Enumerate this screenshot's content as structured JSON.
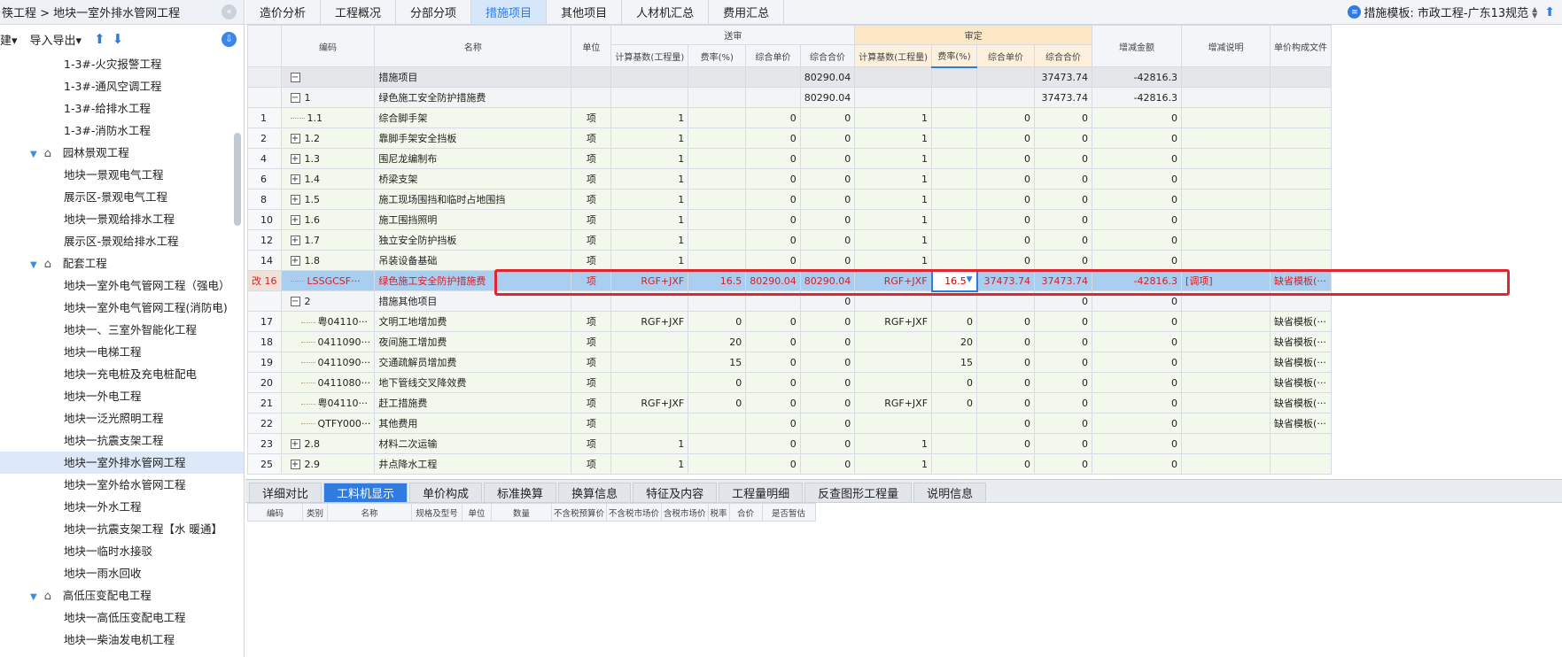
{
  "sidebar": {
    "breadcrumb": "筷工程 > 地块一室外排水管网工程",
    "tools": {
      "new_label": "建▾",
      "import_export_label": "导入导出▾"
    },
    "tree": [
      {
        "label": "1-3#-火灾报警工程",
        "type": "leaf"
      },
      {
        "label": "1-3#-通风空调工程",
        "type": "leaf"
      },
      {
        "label": "1-3#-给排水工程",
        "type": "leaf"
      },
      {
        "label": "1-3#-消防水工程",
        "type": "leaf"
      },
      {
        "label": "园林景观工程",
        "type": "group"
      },
      {
        "label": "地块一景观电气工程",
        "type": "leaf"
      },
      {
        "label": "展示区-景观电气工程",
        "type": "leaf"
      },
      {
        "label": "地块一景观给排水工程",
        "type": "leaf"
      },
      {
        "label": "展示区-景观给排水工程",
        "type": "leaf"
      },
      {
        "label": "配套工程",
        "type": "group"
      },
      {
        "label": "地块一室外电气管网工程（强电）",
        "type": "leaf"
      },
      {
        "label": "地块一室外电气管网工程(消防电)",
        "type": "leaf"
      },
      {
        "label": "地块一、三室外智能化工程",
        "type": "leaf"
      },
      {
        "label": "地块一电梯工程",
        "type": "leaf"
      },
      {
        "label": "地块一充电桩及充电桩配电",
        "type": "leaf"
      },
      {
        "label": "地块一外电工程",
        "type": "leaf"
      },
      {
        "label": "地块一泛光照明工程",
        "type": "leaf"
      },
      {
        "label": "地块一抗震支架工程",
        "type": "leaf"
      },
      {
        "label": "地块一室外排水管网工程",
        "type": "leaf",
        "selected": true
      },
      {
        "label": "地块一室外给水管网工程",
        "type": "leaf"
      },
      {
        "label": "地块一外水工程",
        "type": "leaf"
      },
      {
        "label": "地块一抗震支架工程【水 暖通】",
        "type": "leaf"
      },
      {
        "label": "地块一临时水接驳",
        "type": "leaf"
      },
      {
        "label": "地块一雨水回收",
        "type": "leaf"
      },
      {
        "label": "高低压变配电工程",
        "type": "group"
      },
      {
        "label": "地块一高低压变配电工程",
        "type": "leaf"
      },
      {
        "label": "地块一柴油发电机工程",
        "type": "leaf"
      }
    ]
  },
  "tabs": [
    {
      "label": "造价分析"
    },
    {
      "label": "工程概况"
    },
    {
      "label": "分部分项"
    },
    {
      "label": "措施项目",
      "active": true
    },
    {
      "label": "其他项目"
    },
    {
      "label": "人材机汇总"
    },
    {
      "label": "费用汇总"
    }
  ],
  "template_label": "措施模板: 市政工程-广东13规范",
  "grid": {
    "group_headers": {
      "sent": "送审",
      "audit": "审定"
    },
    "headers": {
      "code": "编码",
      "name": "名称",
      "unit": "单位",
      "s_base": "计算基数(工程量)",
      "s_rate": "费率(%)",
      "s_unit_price": "综合单价",
      "s_total": "综合合价",
      "a_base": "计算基数(工程量)",
      "a_rate": "费率(%)",
      "a_unit_price": "综合单价",
      "a_total": "综合合价",
      "diff": "增减金额",
      "diff_note": "增减说明",
      "price_file": "单价构成文件"
    },
    "rows": [
      {
        "style": "gray",
        "no": "",
        "tree": "box-minus",
        "ind": 0,
        "code": "",
        "name": "措施项目",
        "unit": "",
        "s_base": "",
        "s_rate": "",
        "s_unit_price": "",
        "s_total": "80290.04",
        "a_base": "",
        "a_rate": "",
        "a_unit_price": "",
        "a_total": "37473.74",
        "diff": "-42816.3",
        "note": "",
        "file": "",
        "bold": true
      },
      {
        "style": "sub",
        "no": "",
        "tree": "box-minus",
        "ind": 1,
        "code": "1",
        "name": "绿色施工安全防护措施费",
        "unit": "",
        "s_base": "",
        "s_rate": "",
        "s_unit_price": "",
        "s_total": "80290.04",
        "a_base": "",
        "a_rate": "",
        "a_unit_price": "",
        "a_total": "37473.74",
        "diff": "-42816.3",
        "note": "",
        "file": ""
      },
      {
        "style": "green",
        "no": "1",
        "tree": "dash",
        "ind": 1,
        "code": "1.1",
        "name": "综合脚手架",
        "unit": "项",
        "s_base": "1",
        "s_rate": "",
        "s_unit_price": "0",
        "s_total": "0",
        "a_base": "1",
        "a_rate": "",
        "a_unit_price": "0",
        "a_total": "0",
        "diff": "0",
        "note": "",
        "file": ""
      },
      {
        "style": "green",
        "no": "2",
        "tree": "box-plus",
        "ind": 1,
        "code": "1.2",
        "name": "靠脚手架安全挡板",
        "unit": "项",
        "s_base": "1",
        "s_rate": "",
        "s_unit_price": "0",
        "s_total": "0",
        "a_base": "1",
        "a_rate": "",
        "a_unit_price": "0",
        "a_total": "0",
        "diff": "0",
        "note": "",
        "file": ""
      },
      {
        "style": "green",
        "no": "4",
        "tree": "box-plus",
        "ind": 1,
        "code": "1.3",
        "name": "围尼龙编制布",
        "unit": "项",
        "s_base": "1",
        "s_rate": "",
        "s_unit_price": "0",
        "s_total": "0",
        "a_base": "1",
        "a_rate": "",
        "a_unit_price": "0",
        "a_total": "0",
        "diff": "0",
        "note": "",
        "file": ""
      },
      {
        "style": "green",
        "no": "6",
        "tree": "box-plus",
        "ind": 1,
        "code": "1.4",
        "name": "桥梁支架",
        "unit": "项",
        "s_base": "1",
        "s_rate": "",
        "s_unit_price": "0",
        "s_total": "0",
        "a_base": "1",
        "a_rate": "",
        "a_unit_price": "0",
        "a_total": "0",
        "diff": "0",
        "note": "",
        "file": ""
      },
      {
        "style": "green",
        "no": "8",
        "tree": "box-plus",
        "ind": 1,
        "code": "1.5",
        "name": "施工现场围挡和临时占地围挡",
        "unit": "项",
        "s_base": "1",
        "s_rate": "",
        "s_unit_price": "0",
        "s_total": "0",
        "a_base": "1",
        "a_rate": "",
        "a_unit_price": "0",
        "a_total": "0",
        "diff": "0",
        "note": "",
        "file": ""
      },
      {
        "style": "green",
        "no": "10",
        "tree": "box-plus",
        "ind": 1,
        "code": "1.6",
        "name": "施工围挡照明",
        "unit": "项",
        "s_base": "1",
        "s_rate": "",
        "s_unit_price": "0",
        "s_total": "0",
        "a_base": "1",
        "a_rate": "",
        "a_unit_price": "0",
        "a_total": "0",
        "diff": "0",
        "note": "",
        "file": ""
      },
      {
        "style": "green",
        "no": "12",
        "tree": "box-plus",
        "ind": 1,
        "code": "1.7",
        "name": "独立安全防护挡板",
        "unit": "项",
        "s_base": "1",
        "s_rate": "",
        "s_unit_price": "0",
        "s_total": "0",
        "a_base": "1",
        "a_rate": "",
        "a_unit_price": "0",
        "a_total": "0",
        "diff": "0",
        "note": "",
        "file": ""
      },
      {
        "style": "green",
        "no": "14",
        "tree": "box-plus",
        "ind": 1,
        "code": "1.8",
        "name": "吊装设备基础",
        "unit": "项",
        "s_base": "1",
        "s_rate": "",
        "s_unit_price": "0",
        "s_total": "0",
        "a_base": "1",
        "a_rate": "",
        "a_unit_price": "0",
        "a_total": "0",
        "diff": "0",
        "note": "",
        "file": ""
      },
      {
        "style": "sel",
        "no": "改 16",
        "tree": "dash",
        "ind": 1,
        "code": "LSSGCSF···",
        "name": "绿色施工安全防护措施费",
        "unit": "项",
        "s_base": "RGF+JXF",
        "s_rate": "16.5",
        "s_unit_price": "80290.04",
        "s_total": "80290.04",
        "a_base": "RGF+JXF",
        "a_rate": "16.5",
        "a_unit_price": "37473.74",
        "a_total": "37473.74",
        "diff": "-42816.3",
        "note": "[调项]",
        "file": "缺省模板(···"
      },
      {
        "style": "sub",
        "no": "",
        "tree": "box-minus",
        "ind": 1,
        "code": "2",
        "name": "措施其他项目",
        "unit": "",
        "s_base": "",
        "s_rate": "",
        "s_unit_price": "",
        "s_total": "0",
        "a_base": "",
        "a_rate": "",
        "a_unit_price": "",
        "a_total": "0",
        "diff": "0",
        "note": "",
        "file": ""
      },
      {
        "style": "green",
        "no": "17",
        "tree": "dash",
        "ind": 2,
        "code": "粤04110···",
        "name": "文明工地增加费",
        "unit": "项",
        "s_base": "RGF+JXF",
        "s_rate": "0",
        "s_unit_price": "0",
        "s_total": "0",
        "a_base": "RGF+JXF",
        "a_rate": "0",
        "a_unit_price": "0",
        "a_total": "0",
        "diff": "0",
        "note": "",
        "file": "缺省模板(···"
      },
      {
        "style": "green",
        "no": "18",
        "tree": "dash",
        "ind": 2,
        "code": "0411090···",
        "name": "夜间施工增加费",
        "unit": "项",
        "s_base": "",
        "s_rate": "20",
        "s_unit_price": "0",
        "s_total": "0",
        "a_base": "",
        "a_rate": "20",
        "a_unit_price": "0",
        "a_total": "0",
        "diff": "0",
        "note": "",
        "file": "缺省模板(···"
      },
      {
        "style": "green",
        "no": "19",
        "tree": "dash",
        "ind": 2,
        "code": "0411090···",
        "name": "交通疏解员增加费",
        "unit": "项",
        "s_base": "",
        "s_rate": "15",
        "s_unit_price": "0",
        "s_total": "0",
        "a_base": "",
        "a_rate": "15",
        "a_unit_price": "0",
        "a_total": "0",
        "diff": "0",
        "note": "",
        "file": "缺省模板(···"
      },
      {
        "style": "green",
        "no": "20",
        "tree": "dash",
        "ind": 2,
        "code": "0411080···",
        "name": "地下管线交叉降效费",
        "unit": "项",
        "s_base": "",
        "s_rate": "0",
        "s_unit_price": "0",
        "s_total": "0",
        "a_base": "",
        "a_rate": "0",
        "a_unit_price": "0",
        "a_total": "0",
        "diff": "0",
        "note": "",
        "file": "缺省模板(···"
      },
      {
        "style": "green",
        "no": "21",
        "tree": "dash",
        "ind": 2,
        "code": "粤04110···",
        "name": "赶工措施费",
        "unit": "项",
        "s_base": "RGF+JXF",
        "s_rate": "0",
        "s_unit_price": "0",
        "s_total": "0",
        "a_base": "RGF+JXF",
        "a_rate": "0",
        "a_unit_price": "0",
        "a_total": "0",
        "diff": "0",
        "note": "",
        "file": "缺省模板(···"
      },
      {
        "style": "green",
        "no": "22",
        "tree": "dash",
        "ind": 2,
        "code": "QTFY000···",
        "name": "其他费用",
        "unit": "项",
        "s_base": "",
        "s_rate": "",
        "s_unit_price": "0",
        "s_total": "0",
        "a_base": "",
        "a_rate": "",
        "a_unit_price": "0",
        "a_total": "0",
        "diff": "0",
        "note": "",
        "file": "缺省模板(···"
      },
      {
        "style": "green",
        "no": "23",
        "tree": "box-plus",
        "ind": 1,
        "code": "2.8",
        "name": "材料二次运输",
        "unit": "项",
        "s_base": "1",
        "s_rate": "",
        "s_unit_price": "0",
        "s_total": "0",
        "a_base": "1",
        "a_rate": "",
        "a_unit_price": "0",
        "a_total": "0",
        "diff": "0",
        "note": "",
        "file": ""
      },
      {
        "style": "green",
        "no": "25",
        "tree": "box-plus",
        "ind": 1,
        "code": "2.9",
        "name": "井点降水工程",
        "unit": "项",
        "s_base": "1",
        "s_rate": "",
        "s_unit_price": "0",
        "s_total": "0",
        "a_base": "1",
        "a_rate": "",
        "a_unit_price": "0",
        "a_total": "0",
        "diff": "0",
        "note": "",
        "file": ""
      }
    ]
  },
  "bottom_tabs": [
    {
      "label": "详细对比"
    },
    {
      "label": "工料机显示",
      "active": true
    },
    {
      "label": "单价构成"
    },
    {
      "label": "标准换算"
    },
    {
      "label": "换算信息"
    },
    {
      "label": "特征及内容"
    },
    {
      "label": "工程量明细"
    },
    {
      "label": "反查图形工程量"
    },
    {
      "label": "说明信息"
    }
  ],
  "sub_headers": [
    "编码",
    "类别",
    "名称",
    "规格及型号",
    "单位",
    "数量",
    "不含税预算价",
    "不含税市场价",
    "含税市场价",
    "税率",
    "合价",
    "是否暂估"
  ],
  "colors": {
    "accent": "#2f7be0",
    "highlight_border": "#e0262e",
    "selected_row": "#a9ceef",
    "audit_header": "#fde8c6"
  }
}
